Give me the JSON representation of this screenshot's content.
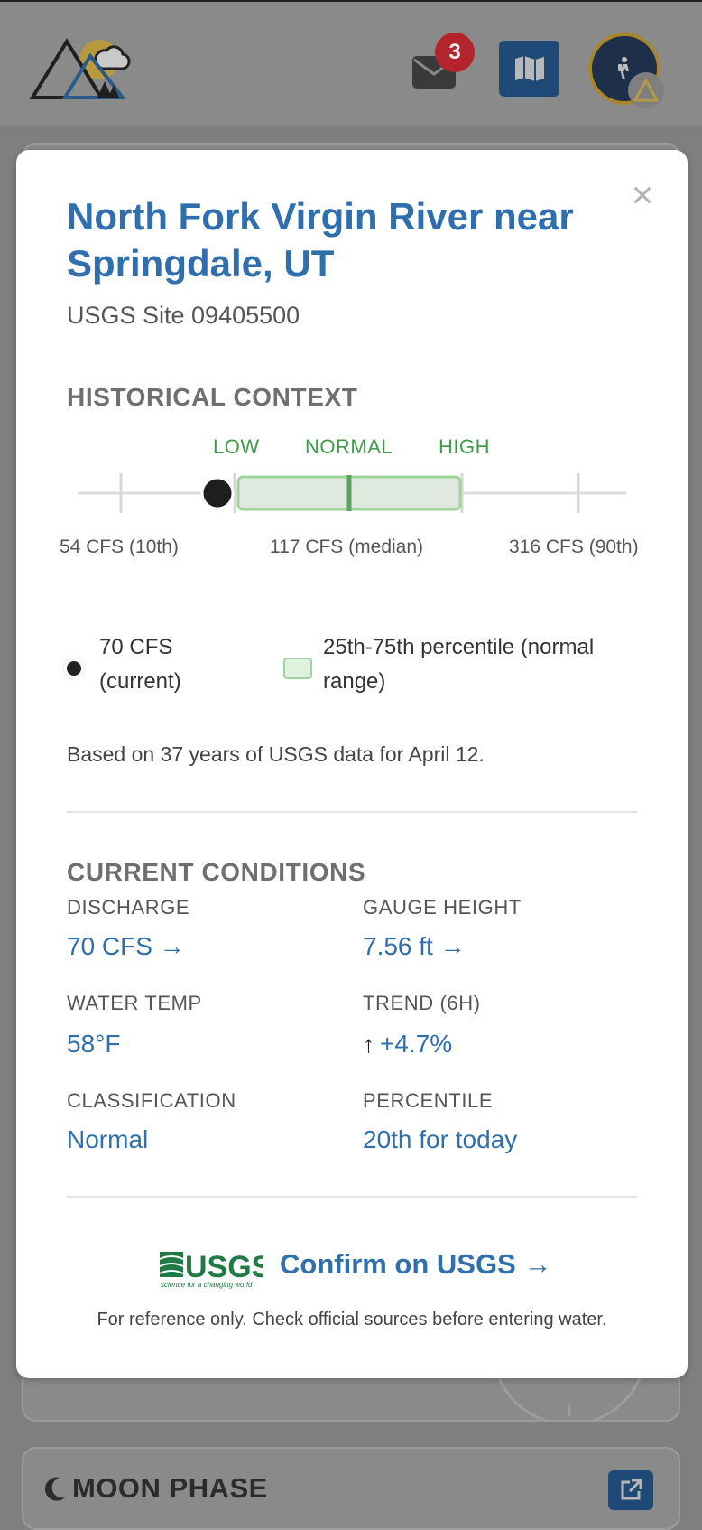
{
  "header": {
    "mail_badge_count": "3",
    "icons": [
      "brand-mountain-logo",
      "mail-icon",
      "map-icon",
      "hiker-avatar-icon",
      "warning-icon"
    ]
  },
  "background": {
    "moon_title": "MOON PHASE"
  },
  "modal": {
    "close_label": "×",
    "title": "North Fork Virgin River near Springdale, UT",
    "subtitle": "USGS Site 09405500",
    "historical": {
      "heading": "HISTORICAL CONTEXT",
      "low_label": "LOW",
      "normal_label": "NORMAL",
      "high_label": "HIGH",
      "p10_label": "54 CFS (10th)",
      "median_label": "117 CFS (median)",
      "p90_label": "316 CFS (90th)",
      "current_percent_of_scale": 0.22,
      "normal_range_start_percent": 0.3,
      "normal_range_end_percent": 0.72,
      "legend_current": "70 CFS (current)",
      "legend_normal": "25th-75th percentile (normal range)",
      "note": "Based on 37 years of USGS data for April 12."
    },
    "current": {
      "heading": "CURRENT CONDITIONS",
      "discharge_label": "DISCHARGE",
      "discharge_value": "70 CFS →",
      "gauge_label": "GAUGE HEIGHT",
      "gauge_value": "7.56 ft →",
      "temp_label": "WATER TEMP",
      "temp_value": "58°F",
      "trend_label": "TREND (6H)",
      "trend_arrow": "↑",
      "trend_value": "+4.7%",
      "class_label": "CLASSIFICATION",
      "class_value": "Normal",
      "percentile_label": "PERCENTILE",
      "percentile_value": "20th for today"
    },
    "footer": {
      "usgs_logo_text": "USGS",
      "usgs_tagline": "science for a changing world",
      "confirm_label": "Confirm on USGS →",
      "disclaimer": "For reference only. Check official sources before entering water."
    }
  },
  "colors": {
    "accent_blue": "#2f6fae",
    "normal_green": "#3f9b4b",
    "badge_red": "#b3242c",
    "nav_blue": "#1f4a78"
  }
}
